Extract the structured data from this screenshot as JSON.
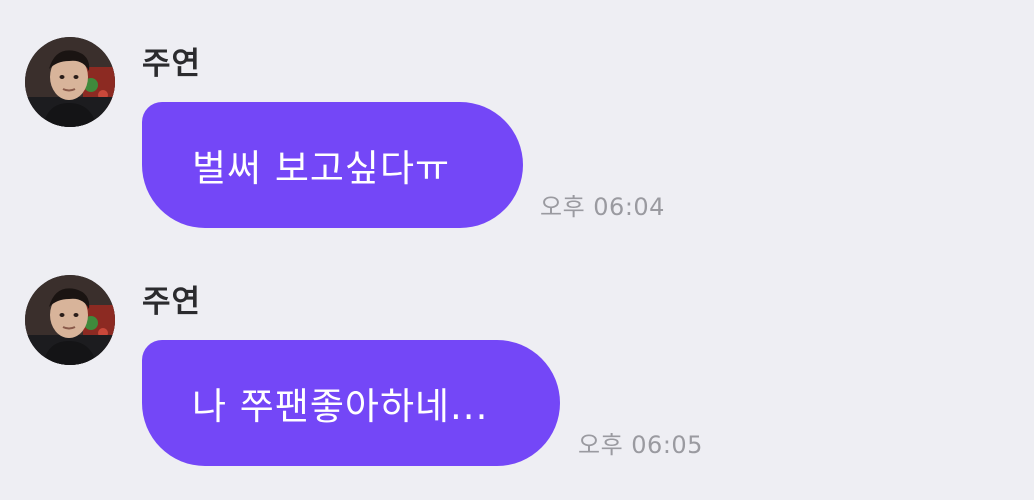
{
  "messages": [
    {
      "sender": "주연",
      "text": "벌써 보고싶다ㅠ",
      "time": "오후 06:04"
    },
    {
      "sender": "주연",
      "text": "나 쭈팬좋아하네...",
      "time": "오후 06:05"
    }
  ],
  "colors": {
    "background": "#eeeef3",
    "bubble": "#7447f7",
    "bubble_text": "#ffffff",
    "sender_text": "#2b2b2e",
    "time_text": "#9a9aa0"
  },
  "icons": {
    "avatar": "profile-photo"
  }
}
